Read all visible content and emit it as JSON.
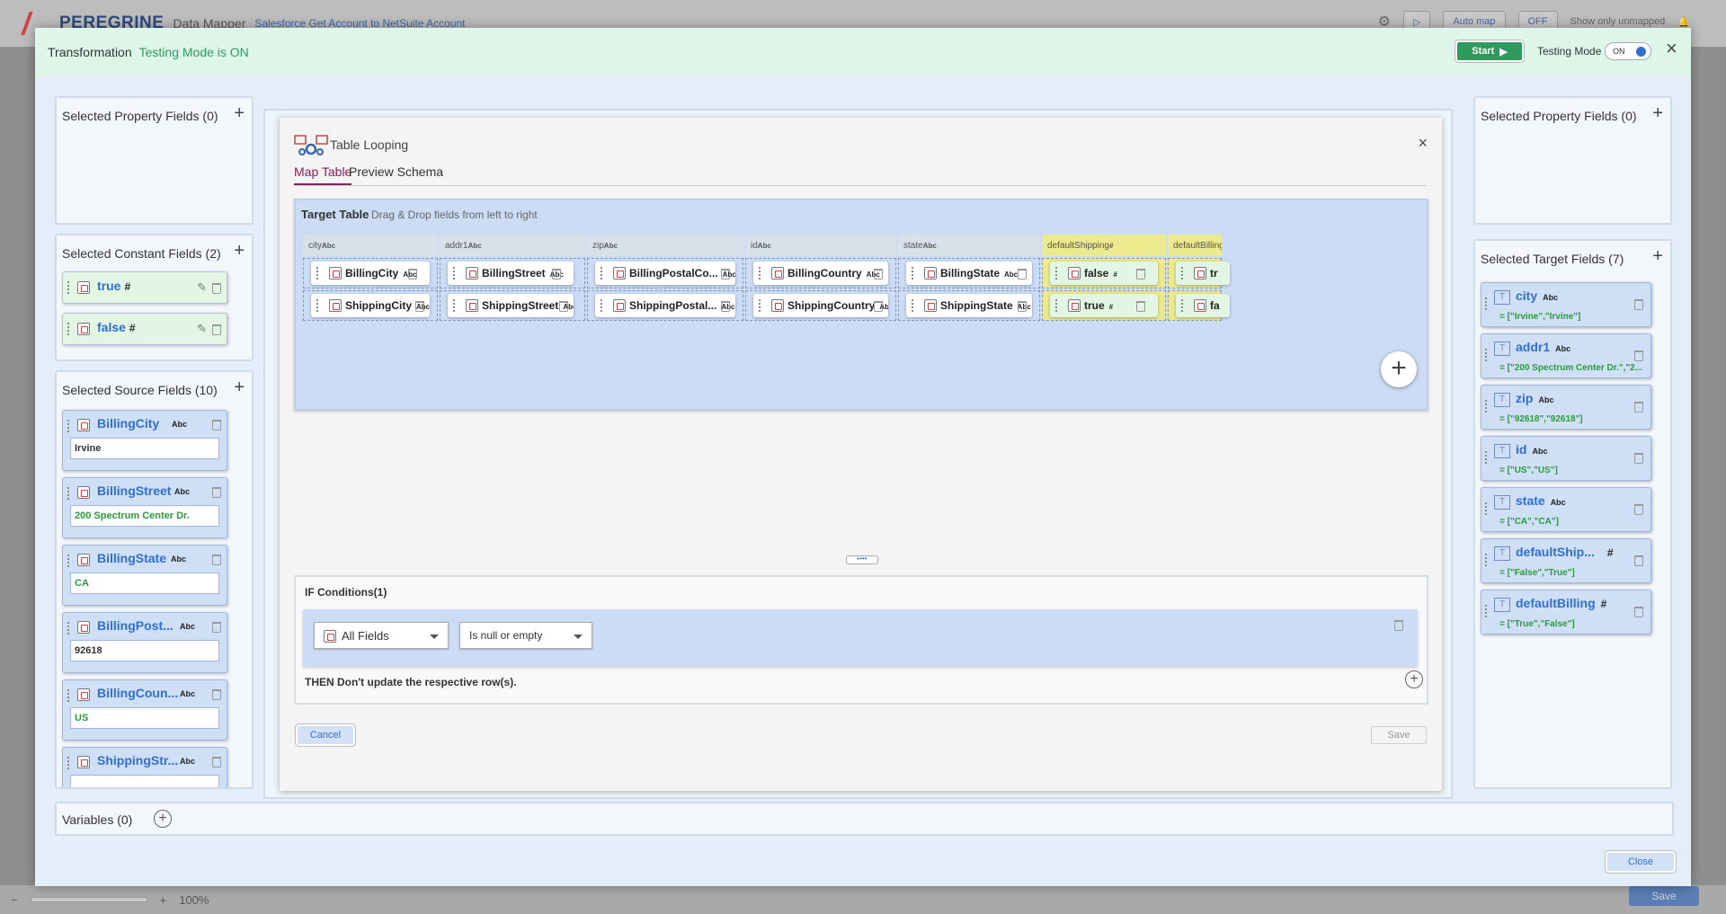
{
  "app": {
    "logo": "PEREGRINE",
    "section": "Data Mapper",
    "breadcrumb": "Salesforce Get Account to NetSuite Account",
    "auto_map": "Auto map",
    "toggle_off": "OFF",
    "show_unmapped": "Show only unmapped",
    "zoom": "100%",
    "save": "Save"
  },
  "modal": {
    "title": "Transformation",
    "status": "Testing Mode is ON",
    "start_label": "Start",
    "testing_mode_label": "Testing Mode",
    "testing_mode_value": "ON",
    "close_label": "Close"
  },
  "left": {
    "property_title": "Selected Property Fields (0)",
    "constant_title": "Selected Constant Fields (2)",
    "constants": [
      {
        "label": "true",
        "type": "#"
      },
      {
        "label": "false",
        "type": "#"
      }
    ],
    "source_title": "Selected Source Fields (10)",
    "sources": [
      {
        "name": "BillingCity",
        "type": "Abc",
        "value": "Irvine",
        "green": false
      },
      {
        "name": "BillingStreet",
        "type": "Abc",
        "value": "200 Spectrum Center Dr.",
        "green": true
      },
      {
        "name": "BillingState",
        "type": "Abc",
        "value": "CA",
        "green": true
      },
      {
        "name": "BillingPost...",
        "type": "Abc",
        "value": "92618",
        "green": false
      },
      {
        "name": "BillingCoun...",
        "type": "Abc",
        "value": "US",
        "green": true
      },
      {
        "name": "ShippingStr...",
        "type": "Abc",
        "value": "",
        "green": false
      }
    ]
  },
  "looping": {
    "title": "Table Looping",
    "tab_map": "Map Table",
    "tab_preview": "Preview Schema",
    "target_title": "Target Table",
    "target_hint": "Drag & Drop fields from left to right",
    "columns": [
      {
        "name": "city",
        "type": "Abc"
      },
      {
        "name": "addr1",
        "type": "Abc"
      },
      {
        "name": "zip",
        "type": "Abc"
      },
      {
        "name": "id",
        "type": "Abc"
      },
      {
        "name": "state",
        "type": "Abc"
      },
      {
        "name": "defaultShipping",
        "type": "#"
      },
      {
        "name": "defaultBilling",
        "type": ""
      }
    ],
    "rows": [
      [
        {
          "name": "BillingCity",
          "type": "Abc"
        },
        {
          "name": "BillingStreet",
          "type": "Abc"
        },
        {
          "name": "BillingPostalCo...",
          "type": "Abc"
        },
        {
          "name": "BillingCountry",
          "type": "Abc"
        },
        {
          "name": "BillingState",
          "type": "Abc"
        },
        {
          "name": "false",
          "type": "#"
        },
        {
          "name": "tr",
          "type": ""
        }
      ],
      [
        {
          "name": "ShippingCity",
          "type": "Abc"
        },
        {
          "name": "ShippingStreet",
          "type": "Abc"
        },
        {
          "name": "ShippingPostal...",
          "type": "Abc"
        },
        {
          "name": "ShippingCountry",
          "type": "Abc"
        },
        {
          "name": "ShippingState",
          "type": "Abc"
        },
        {
          "name": "true",
          "type": "#"
        },
        {
          "name": "fa",
          "type": ""
        }
      ]
    ],
    "resizer": "••••",
    "if_title": "IF Conditions(1)",
    "if_field": "All Fields",
    "if_operator": "Is null or empty",
    "then_text": "THEN Don't update the respective row(s).",
    "cancel": "Cancel",
    "save": "Save"
  },
  "right": {
    "property_title": "Selected Property Fields (0)",
    "target_title": "Selected Target Fields (7)",
    "targets": [
      {
        "name": "city",
        "type": "Abc",
        "value": "= [\"Irvine\",\"Irvine\"]"
      },
      {
        "name": "addr1",
        "type": "Abc",
        "value": "= [\"200 Spectrum Center Dr.\",\"2..."
      },
      {
        "name": "zip",
        "type": "Abc",
        "value": "= [\"92618\",\"92618\"]"
      },
      {
        "name": "id",
        "type": "Abc",
        "value": "= [\"US\",\"US\"]"
      },
      {
        "name": "state",
        "type": "Abc",
        "value": "= [\"CA\",\"CA\"]"
      },
      {
        "name": "defaultShip...",
        "type": "#",
        "value": "= [\"False\",\"True\"]"
      },
      {
        "name": "defaultBilling",
        "type": "#",
        "value": "= [\"True\",\"False\"]"
      }
    ]
  },
  "variables_title": "Variables (0)"
}
